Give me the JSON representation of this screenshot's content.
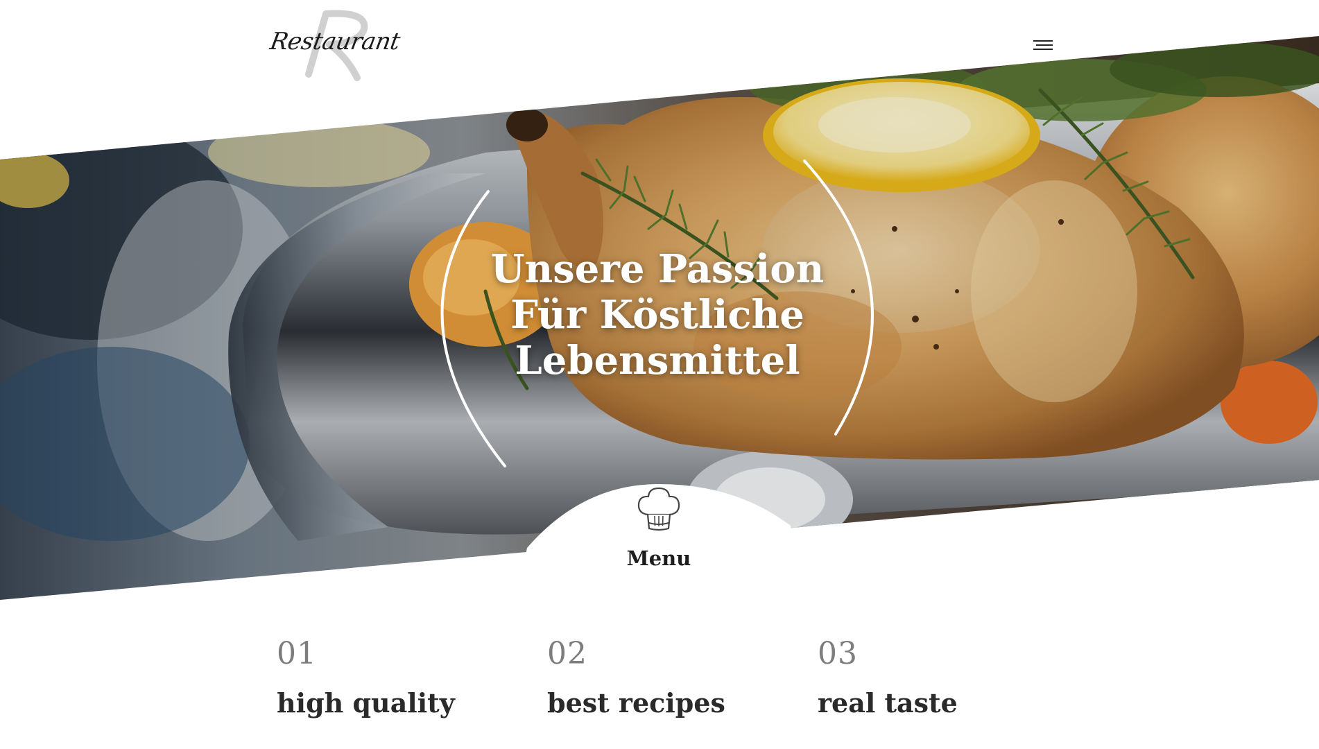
{
  "brand": {
    "logo_text": "Restaurant",
    "logo_monogram": "R"
  },
  "nav": {
    "menu_toggle_icon": "hamburger-menu-icon"
  },
  "hero": {
    "title_lines": [
      "Unsere Passion",
      "Für Köstliche",
      "Lebensmittel"
    ]
  },
  "menu_tab": {
    "label": "Menu",
    "icon": "chef-hat-icon"
  },
  "features": [
    {
      "number": "01",
      "title": "high quality"
    },
    {
      "number": "02",
      "title": "best recipes"
    },
    {
      "number": "03",
      "title": "real taste"
    }
  ],
  "colors": {
    "text_dark": "#1e1e1e",
    "number_gray": "#7d7d7d",
    "background": "#ffffff",
    "hero_text": "#ffffff"
  }
}
